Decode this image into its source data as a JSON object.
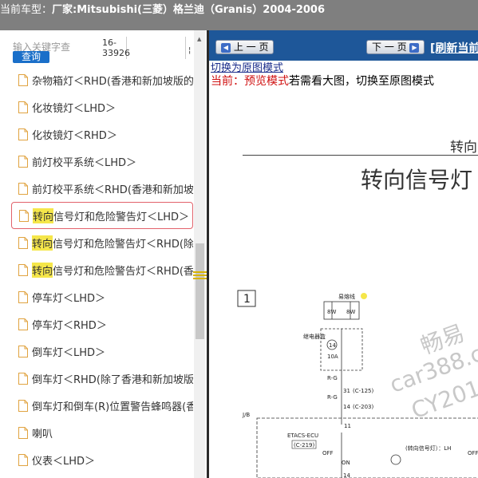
{
  "header": {
    "label": "当前车型：",
    "model": "厂家:Mitsubishi(三菱）格兰迪（Granis）2004-2006"
  },
  "search": {
    "placeholder": "输入关键字查",
    "button": "查询",
    "code": "16-33926"
  },
  "list": [
    {
      "pre": "",
      "hl": "",
      "text": "杂物箱灯＜RHD(香港和新加坡版的)"
    },
    {
      "pre": "",
      "hl": "",
      "text": "化妆镜灯＜LHD＞"
    },
    {
      "pre": "",
      "hl": "",
      "text": "化妆镜灯＜RHD＞"
    },
    {
      "pre": "",
      "hl": "",
      "text": "前灯校平系统＜LHD＞"
    },
    {
      "pre": "",
      "hl": "",
      "text": "前灯校平系统＜RHD(香港和新加坡"
    },
    {
      "pre": "",
      "hl": "转向",
      "text": "信号灯和危险警告灯＜LHD＞",
      "selected": true
    },
    {
      "pre": "",
      "hl": "转向",
      "text": "信号灯和危险警告灯＜RHD(除"
    },
    {
      "pre": "",
      "hl": "转向",
      "text": "信号灯和危险警告灯＜RHD(香"
    },
    {
      "pre": "",
      "hl": "",
      "text": "停车灯＜LHD＞"
    },
    {
      "pre": "",
      "hl": "",
      "text": "停车灯＜RHD＞"
    },
    {
      "pre": "",
      "hl": "",
      "text": "倒车灯＜LHD＞"
    },
    {
      "pre": "",
      "hl": "",
      "text": "倒车灯＜RHD(除了香港和新加坡版"
    },
    {
      "pre": "",
      "hl": "",
      "text": "倒车灯和倒车(R)位置警告蜂鸣器(香"
    },
    {
      "pre": "",
      "hl": "",
      "text": "喇叭"
    },
    {
      "pre": "",
      "hl": "",
      "text": "仪表＜LHD＞"
    }
  ],
  "nav": {
    "prev": "上 一 页",
    "next": "下 一 页",
    "refresh": "[刷新当前"
  },
  "viewer": {
    "switch_link": "切换为原图模式",
    "preview_prefix": "当前：预览模式",
    "preview_suffix": "若需看大图，切换至原图模式"
  },
  "doc": {
    "small_title": "转向",
    "big_title": "转向信号灯",
    "diagram_number": "1",
    "labels": {
      "fuse_link": "易熔线",
      "fuse_rating_a": "8W",
      "fuse_rating_b": "8W",
      "relay_box": "继电器盒",
      "fuse_no": "14",
      "fuse_amp": "10A",
      "wire_a": "R-G",
      "wire_b": "R-G",
      "conn_a_pin": "31",
      "conn_a": "(C-125)",
      "conn_b_pin": "14",
      "conn_b": "(C-203)",
      "jb": "J/B",
      "pin_11": "11",
      "etacs": "ETACS-ECU",
      "conn_c": "(C-219)",
      "off": "OFF",
      "on": "ON",
      "lamp": "(转向信号灯）：LH",
      "off_right": "OFF",
      "pin_14": "14"
    },
    "watermarks": [
      "畅易",
      "car388.c",
      "CY201"
    ]
  },
  "colors": {
    "topbar": "#7f7f7f",
    "navbar": "#1e5799",
    "search_button": "#1a6fc9",
    "highlight": "#f5e64a",
    "selected_border": "#e2626b",
    "preview_red": "#d01010"
  }
}
